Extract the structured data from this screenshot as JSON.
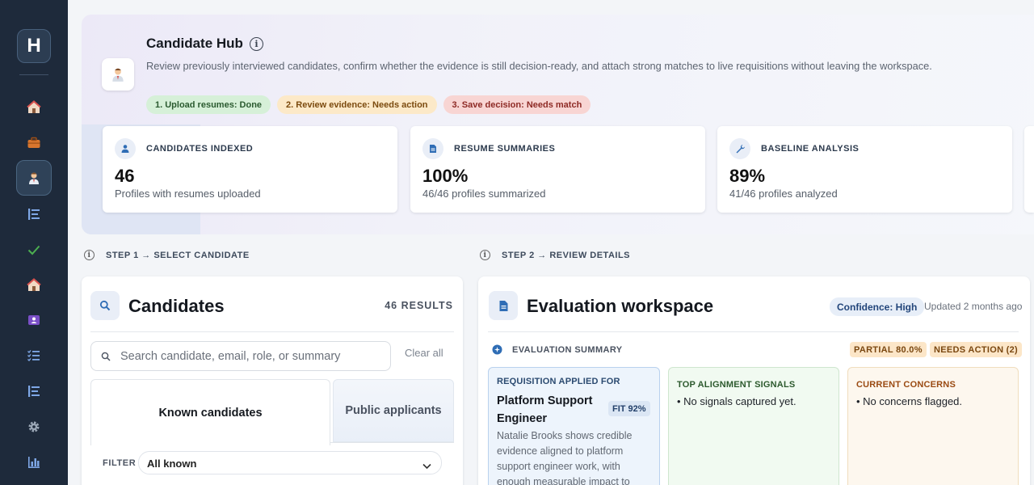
{
  "sidebar": {
    "logo": "H",
    "items": [
      {
        "name": "home",
        "icon": "home-icon"
      },
      {
        "name": "jobs",
        "icon": "briefcase-icon"
      },
      {
        "name": "candidates",
        "icon": "person-icon",
        "active": true
      },
      {
        "name": "pipeline",
        "icon": "list-icon"
      },
      {
        "name": "approvals",
        "icon": "check-icon"
      },
      {
        "name": "offices",
        "icon": "home-icon"
      },
      {
        "name": "profiles",
        "icon": "id-card-icon"
      },
      {
        "name": "tasks",
        "icon": "checklist-icon"
      },
      {
        "name": "lists",
        "icon": "list-icon"
      },
      {
        "name": "settings",
        "icon": "gear-icon"
      },
      {
        "name": "analytics",
        "icon": "bar-chart-icon"
      }
    ]
  },
  "hero": {
    "title": "Candidate Hub",
    "description": "Review previously interviewed candidates, confirm whether the evidence is still decision-ready, and attach strong matches to live requisitions without leaving the workspace.",
    "steps": [
      "1. Upload resumes: Done",
      "2. Review evidence: Needs action",
      "3. Save decision: Needs match"
    ]
  },
  "stats": [
    {
      "label": "CANDIDATES INDEXED",
      "value": "46",
      "sub": "Profiles with resumes uploaded",
      "icon": "person-icon"
    },
    {
      "label": "RESUME SUMMARIES",
      "value": "100%",
      "sub": "46/46 profiles summarized",
      "icon": "document-icon"
    },
    {
      "label": "BASELINE ANALYSIS",
      "value": "89%",
      "sub": "41/46 profiles analyzed",
      "icon": "wrench-icon"
    }
  ],
  "step1": {
    "label": "STEP 1 → SELECT CANDIDATE"
  },
  "step2": {
    "label": "STEP 2 → REVIEW DETAILS"
  },
  "candidates": {
    "title": "Candidates",
    "results": "46 RESULTS",
    "search_placeholder": "Search candidate, email, role, or summary",
    "clear_all": "Clear all",
    "tabs": [
      "Known candidates",
      "Public applicants"
    ],
    "filter_label": "FILTER",
    "filter_value": "All known"
  },
  "evaluation": {
    "title": "Evaluation workspace",
    "confidence": "Confidence: High",
    "updated": "Updated 2 months ago",
    "summary_label": "EVALUATION SUMMARY",
    "partial": "PARTIAL 80.0%",
    "needs_action": "NEEDS ACTION (2)",
    "requisition": {
      "label": "REQUISITION APPLIED FOR",
      "title": "Platform Support Engineer",
      "fit": "FIT 92%",
      "description": "Natalie Brooks shows credible evidence aligned to platform support engineer work, with enough measurable impact to"
    },
    "signals": {
      "label": "TOP ALIGNMENT SIGNALS",
      "item": "No signals captured yet."
    },
    "concerns": {
      "label": "CURRENT CONCERNS",
      "item": "No concerns flagged."
    }
  }
}
